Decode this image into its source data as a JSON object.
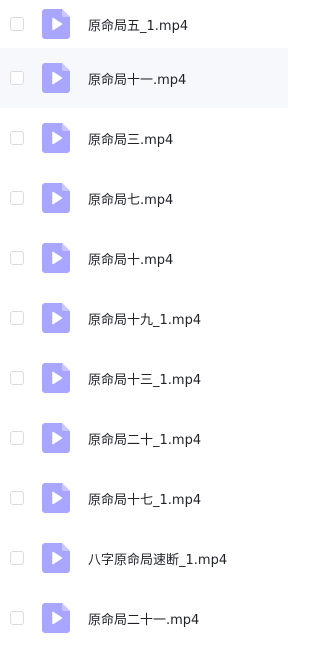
{
  "files": [
    {
      "name": "原命局五_1.mp4",
      "icon": "video-file-icon"
    },
    {
      "name": "原命局十一.mp4",
      "icon": "video-file-icon"
    },
    {
      "name": "原命局三.mp4",
      "icon": "video-file-icon"
    },
    {
      "name": "原命局七.mp4",
      "icon": "video-file-icon"
    },
    {
      "name": "原命局十.mp4",
      "icon": "video-file-icon"
    },
    {
      "name": "原命局十九_1.mp4",
      "icon": "video-file-icon"
    },
    {
      "name": "原命局十三_1.mp4",
      "icon": "video-file-icon"
    },
    {
      "name": "原命局二十_1.mp4",
      "icon": "video-file-icon"
    },
    {
      "name": "原命局十七_1.mp4",
      "icon": "video-file-icon"
    },
    {
      "name": "八字原命局速断_1.mp4",
      "icon": "video-file-icon"
    },
    {
      "name": "原命局二十一.mp4",
      "icon": "video-file-icon"
    }
  ],
  "colors": {
    "icon_fill": "#a9a6ff",
    "icon_fold": "#c9c7ff",
    "play_fill": "#ffffff",
    "hover_bg": "#f7f8fb",
    "text": "#1f2329"
  }
}
